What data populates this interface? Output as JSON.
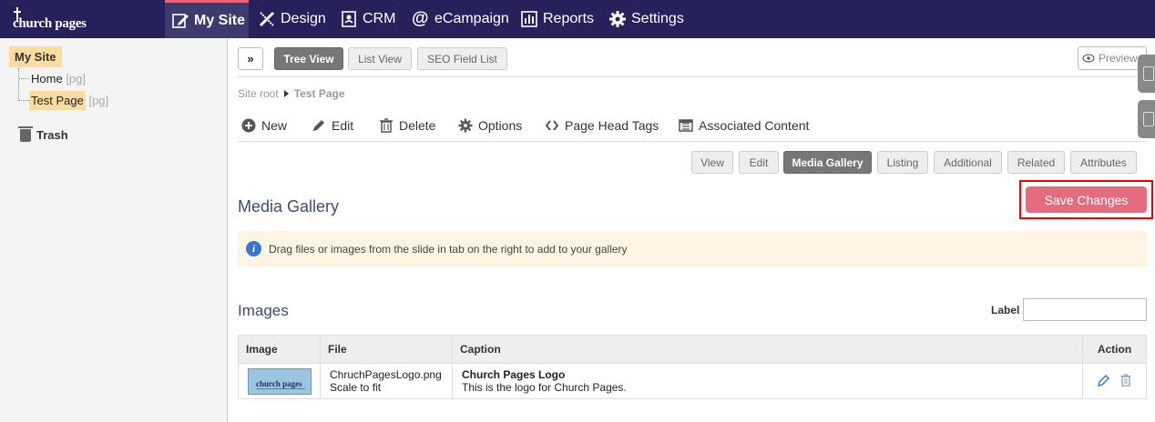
{
  "brand": {
    "logo_text": "church pages"
  },
  "nav": {
    "items": [
      {
        "label": "My Site",
        "icon": "edit-icon",
        "active": true
      },
      {
        "label": "Design",
        "icon": "pencil-ruler-icon"
      },
      {
        "label": "CRM",
        "icon": "contacts-icon"
      },
      {
        "label": "eCampaign",
        "icon": "at-icon"
      },
      {
        "label": "Reports",
        "icon": "bar-chart-icon"
      },
      {
        "label": "Settings",
        "icon": "gear-icon"
      }
    ]
  },
  "sidebar": {
    "root": "My Site",
    "children": [
      {
        "label": "Home",
        "tag": "[pg]"
      },
      {
        "label": "Test Page",
        "tag": "[pg]",
        "selected": true
      }
    ],
    "trash": "Trash"
  },
  "toolbar": {
    "views": [
      "Tree View",
      "List View",
      "SEO Field List"
    ],
    "preview": "Preview"
  },
  "breadcrumb": {
    "root": "Site root",
    "current": "Test Page"
  },
  "actions": [
    "New",
    "Edit",
    "Delete",
    "Options",
    "Page Head Tags",
    "Associated Content"
  ],
  "tabs": [
    "View",
    "Edit",
    "Media Gallery",
    "Listing",
    "Additional",
    "Related",
    "Attributes"
  ],
  "active_tab": "Media Gallery",
  "section": {
    "title": "Media Gallery",
    "save_label": "Save Changes",
    "info": "Drag files or images from the slide in tab on the right to add to your gallery"
  },
  "images": {
    "title": "Images",
    "label_caption": "Label",
    "label_value": "",
    "columns": [
      "Image",
      "File",
      "Caption",
      "Action"
    ],
    "rows": [
      {
        "thumb_text": "church pages",
        "file": "ChruchPagesLogo.png",
        "scale": "Scale to fit",
        "caption_title": "Church Pages Logo",
        "caption_text": "This is the logo for Church Pages."
      }
    ]
  },
  "colors": {
    "nav_bg": "#26215a",
    "accent": "#e56c7e",
    "highlight": "#fbdc9e",
    "info_bg": "#fdf4e4",
    "info_icon": "#3778c8"
  }
}
